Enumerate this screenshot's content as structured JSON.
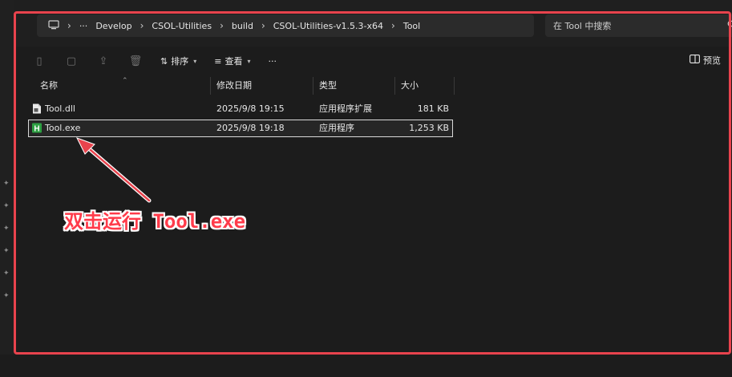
{
  "breadcrumb": {
    "overflow": "···",
    "items": [
      "Develop",
      "CSOL-Utilities",
      "build",
      "CSOL-Utilities-v1.5.3-x64",
      "Tool"
    ],
    "separator": "›"
  },
  "search": {
    "placeholder": "在 Tool 中搜索",
    "icon": "search-icon"
  },
  "toolbar": {
    "sort_label": "排序",
    "view_label": "查看",
    "more_label": "···",
    "preview_label": "预览"
  },
  "columns": {
    "name": "名称",
    "modified": "修改日期",
    "type": "类型",
    "size": "大小"
  },
  "files": [
    {
      "name": "Tool.dll",
      "modified": "2025/9/8 19:15",
      "type": "应用程序扩展",
      "size": "181 KB",
      "icon": "dll-file-icon"
    },
    {
      "name": "Tool.exe",
      "modified": "2025/9/8 19:18",
      "type": "应用程序",
      "size": "1,253 KB",
      "icon": "exe-file-icon",
      "selected": true
    }
  ],
  "annotation": {
    "text": "双击运行 Tool.exe"
  },
  "colors": {
    "highlight_red": "#e8434d",
    "annotation_red": "#ff3b4a",
    "exe_green": "#2ea043"
  }
}
